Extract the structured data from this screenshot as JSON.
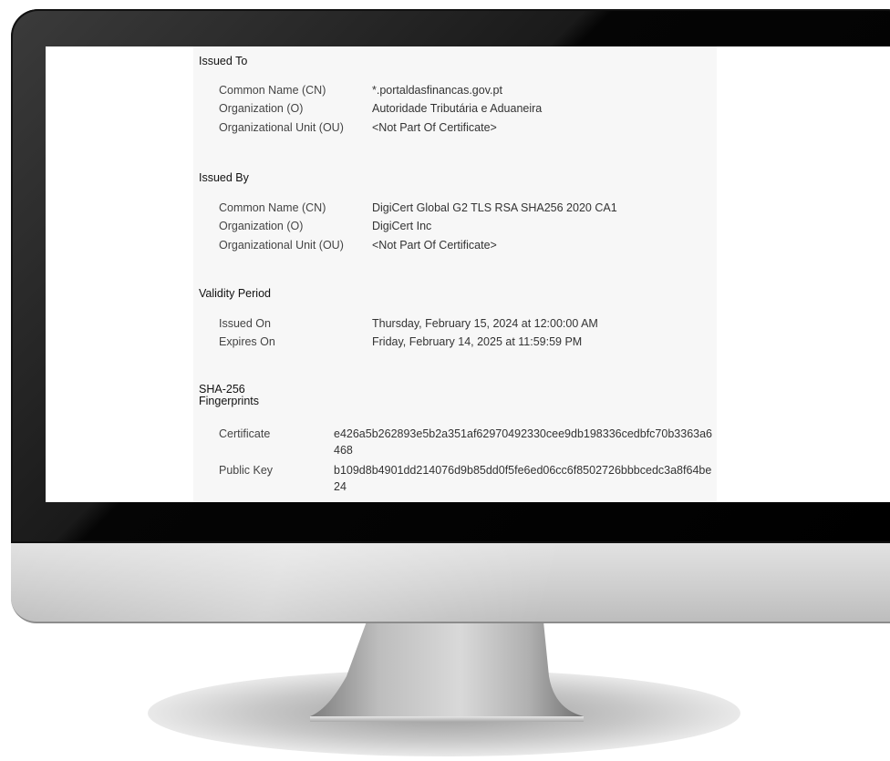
{
  "issued_to": {
    "title": "Issued To",
    "rows": [
      {
        "label": "Common Name (CN)",
        "value": "*.portaldasfinancas.gov.pt"
      },
      {
        "label": "Organization (O)",
        "value": "Autoridade Tributária e Aduaneira"
      },
      {
        "label": "Organizational Unit (OU)",
        "value": "<Not Part Of Certificate>"
      }
    ]
  },
  "issued_by": {
    "title": "Issued By",
    "rows": [
      {
        "label": "Common Name (CN)",
        "value": "DigiCert Global G2 TLS RSA SHA256 2020 CA1"
      },
      {
        "label": "Organization (O)",
        "value": "DigiCert Inc"
      },
      {
        "label": "Organizational Unit (OU)",
        "value": "<Not Part Of Certificate>"
      }
    ]
  },
  "validity": {
    "title": "Validity Period",
    "rows": [
      {
        "label": "Issued On",
        "value": "Thursday, February 15, 2024 at 12:00:00 AM"
      },
      {
        "label": "Expires On",
        "value": "Friday, February 14, 2025 at 11:59:59 PM"
      }
    ]
  },
  "fingerprints": {
    "title_line1": "SHA-256",
    "title_line2": "Fingerprints",
    "rows": [
      {
        "label": "Certificate",
        "value": "e426a5b262893e5b2a351af62970492330cee9db198336cedbfc70b3363a6468"
      },
      {
        "label": "Public Key",
        "value": "b109d8b4901dd214076d9b85dd0f5fe6ed06cc6f8502726bbbcedc3a8f64be24"
      }
    ]
  }
}
